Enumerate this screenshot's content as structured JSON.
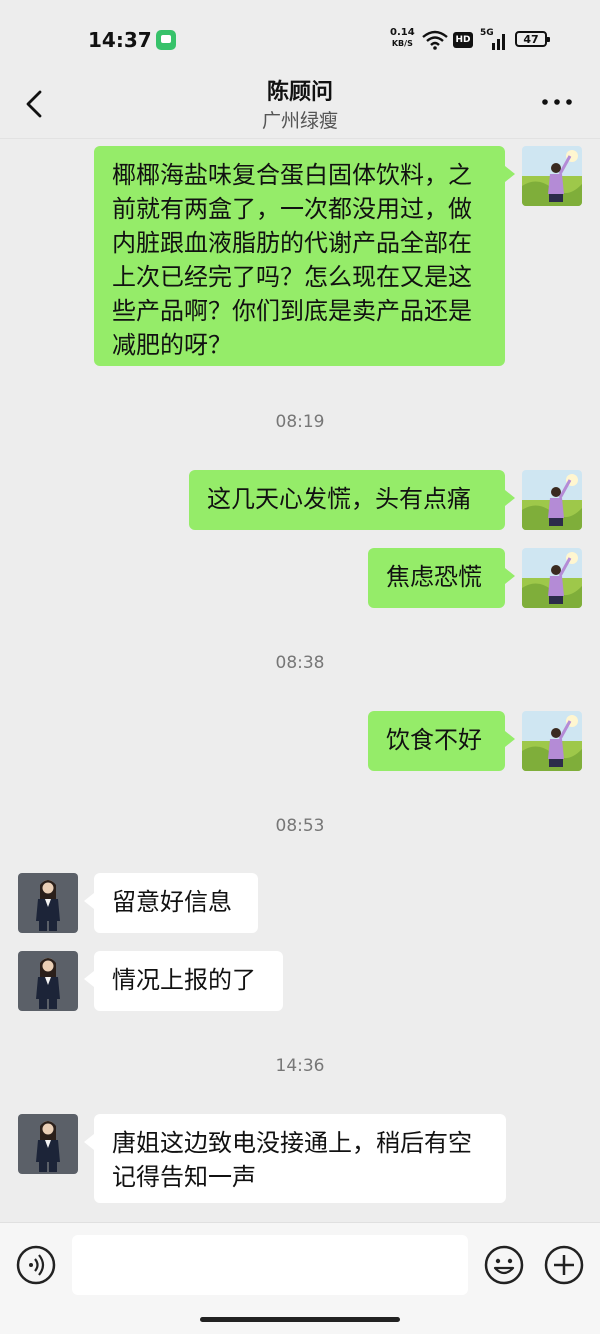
{
  "status_bar": {
    "time": "14:37",
    "net_speed_value": "0.14",
    "net_speed_unit": "KB/S",
    "hd_label": "HD",
    "network_label": "5G",
    "battery": "47"
  },
  "header": {
    "title": "陈顾问",
    "subtitle": "广州绿瘦",
    "back_icon": "chevron-left-icon",
    "more_icon": "more-dots-icon"
  },
  "messages": [
    {
      "sender": "me",
      "text": "椰椰海盐味复合蛋白固体饮料，之前就有两盒了，一次都没用过，做内脏跟血液脂肪的代谢产品全部在上次已经完了吗？怎么现在又是这些产品啊？你们到底是卖产品还是减肥的呀？"
    },
    {
      "type": "timestamp",
      "text": "08:19"
    },
    {
      "sender": "me",
      "text": "这几天心发慌，头有点痛"
    },
    {
      "sender": "me",
      "text": "焦虑恐慌"
    },
    {
      "type": "timestamp",
      "text": "08:38"
    },
    {
      "sender": "me",
      "text": "饮食不好"
    },
    {
      "type": "timestamp",
      "text": "08:53"
    },
    {
      "sender": "other",
      "text": "留意好信息"
    },
    {
      "sender": "other",
      "text": "情况上报的了"
    },
    {
      "type": "timestamp",
      "text": "14:36"
    },
    {
      "sender": "other",
      "text": "唐姐这边致电没接通上，稍后有空记得告知一声"
    }
  ],
  "input_bar": {
    "voice_icon": "voice-icon",
    "input_value": "",
    "emoji_icon": "emoji-icon",
    "plus_icon": "plus-icon"
  },
  "colors": {
    "background": "#ededed",
    "my_bubble": "#95ec69",
    "their_bubble": "#ffffff",
    "timestamp": "#777777"
  }
}
